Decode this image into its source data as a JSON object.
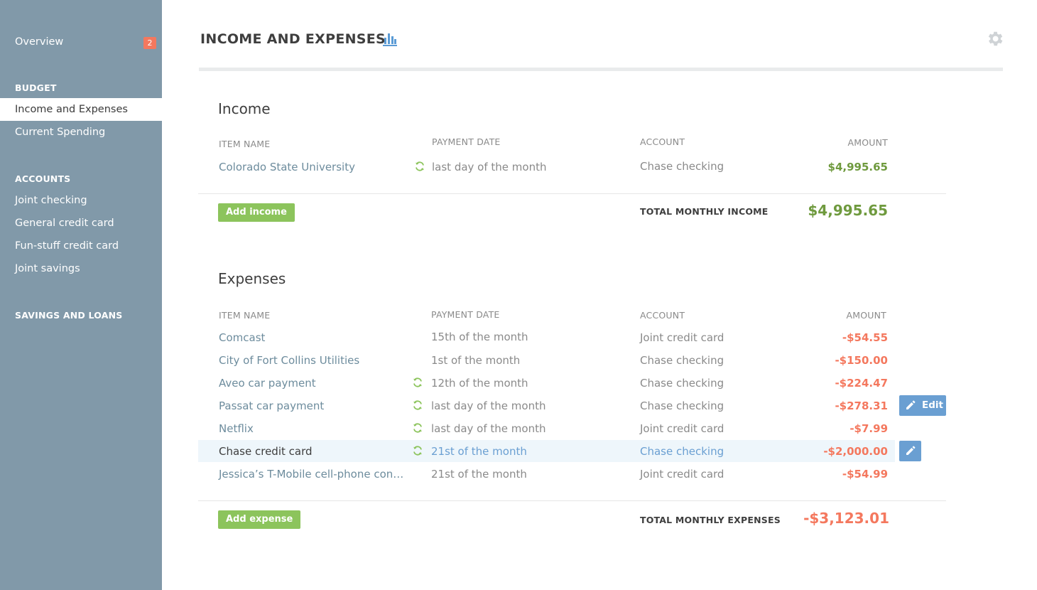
{
  "sidebar": {
    "overview": {
      "label": "Overview",
      "badge": "2"
    },
    "budget_heading": "BUDGET",
    "budget_items": [
      "Income and Expenses",
      "Current Spending"
    ],
    "accounts_heading": "ACCOUNTS",
    "account_items": [
      "Joint checking",
      "General credit card",
      "Fun-stuff credit card",
      "Joint savings"
    ],
    "savings_heading": "SAVINGS AND LOANS"
  },
  "header": {
    "title": "INCOME AND EXPENSES",
    "chart_icon": "bar-chart-icon",
    "settings_icon": "gear-icon"
  },
  "income": {
    "title": "Income",
    "columns": {
      "item": "ITEM NAME",
      "date": "PAYMENT DATE",
      "account": "ACCOUNT",
      "amount": "AMOUNT"
    },
    "rows": [
      {
        "name": "Colorado State University",
        "recurring": true,
        "date": "last day of the month",
        "account": "Chase checking",
        "amount": "$4,995.65"
      }
    ],
    "add_button": "Add income",
    "total_label": "TOTAL MONTHLY INCOME",
    "total_value": "$4,995.65"
  },
  "expenses": {
    "title": "Expenses",
    "columns": {
      "item": "ITEM NAME",
      "date": "PAYMENT DATE",
      "account": "ACCOUNT",
      "amount": "AMOUNT"
    },
    "rows": [
      {
        "name": "Comcast",
        "recurring": false,
        "date": "15th of the month",
        "account": "Joint credit card",
        "amount": "-$54.55"
      },
      {
        "name": "City of Fort Collins Utilities",
        "recurring": false,
        "date": "1st of the month",
        "account": "Chase checking",
        "amount": "-$150.00"
      },
      {
        "name": "Aveo car payment",
        "recurring": true,
        "date": "12th of the month",
        "account": "Chase checking",
        "amount": "-$224.47"
      },
      {
        "name": "Passat car payment",
        "recurring": true,
        "date": "last day of the month",
        "account": "Chase checking",
        "amount": "-$278.31"
      },
      {
        "name": "Netflix",
        "recurring": true,
        "date": "last day of the month",
        "account": "Joint credit card",
        "amount": "-$7.99"
      },
      {
        "name": "Chase credit card",
        "recurring": true,
        "date": "21st of the month",
        "account": "Chase checking",
        "amount": "-$2,000.00"
      },
      {
        "name": "Jessica’s T-Mobile cell-phone con…",
        "recurring": false,
        "date": "21st of the month",
        "account": "Joint credit card",
        "amount": "-$54.99"
      }
    ],
    "edit_label": "Edit",
    "add_button": "Add expense",
    "total_label": "TOTAL MONTHLY EXPENSES",
    "total_value": "-$3,123.01"
  },
  "colors": {
    "sidebar_bg": "#8199a9",
    "positive": "#6f9a3e",
    "negative": "#f4785e",
    "accent_blue": "#6a9fd2",
    "button_green": "#8cc45c",
    "badge": "#f4785e"
  }
}
